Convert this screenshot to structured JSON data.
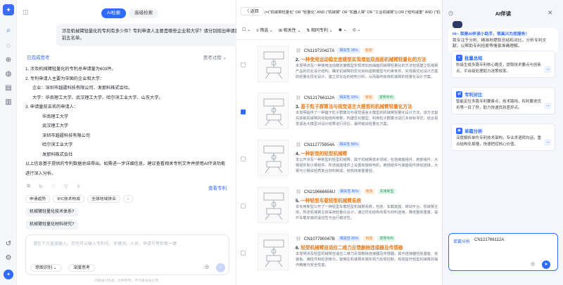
{
  "rail": {
    "logo": "✦",
    "icons": [
      "search-icon",
      "chat-icon",
      "globe-icon",
      "compass-icon",
      "document-icon",
      "book-icon",
      "history-icon",
      "settings-icon"
    ],
    "avatar": "✦"
  },
  "chat": {
    "tabs": [
      "AI检索",
      "高级检索"
    ],
    "user_question": "涉及机械臂轻量化的专利有多少件？专利申请人主要是哪些企业和大学？请分别按出申请量前五名单。",
    "thinking_label": "已完成思考",
    "thinking_toggle": "思考过程 ⌄",
    "answer_lines": [
      {
        "text": "1. 涉及机械臂轻量化的专利总申请量为603件。",
        "indent": 0
      },
      {
        "text": "2. 专利申请人主要为中国的企业和大学：",
        "indent": 0
      },
      {
        "text": "企业：深圳市越疆科技有限公司、发那科株式会社。",
        "indent": 1
      },
      {
        "text": "大学：华南理工大学、武汉理工大学、哈尔滨工业大学、山东大学。",
        "indent": 1
      },
      {
        "text": "3. 申请量前五名的申请人：",
        "indent": 0
      },
      {
        "text": "华南理工大学",
        "indent": 2
      },
      {
        "text": "武汉理工大学",
        "indent": 2
      },
      {
        "text": "深圳市越疆科技有限公司",
        "indent": 2
      },
      {
        "text": "哈尔滨工业大学",
        "indent": 2
      },
      {
        "text": "发那科株式会社",
        "indent": 2
      },
      {
        "text": "以上信息基于提供的专利数据总结得出。如需进一步详细信息，建议查看相关专利文件并使用AI伴读功能进行深入分析。",
        "indent": 0
      }
    ],
    "view_patents": "查看专利",
    "chips": [
      "申请趋势",
      "IPC技术构成",
      "全球地域排名"
    ],
    "chip_more": "›",
    "suggestions": [
      "机械臂轻量化技术体系?",
      "机械臂轻量化材料研究?"
    ],
    "input_placeholder": "请在下方直接输入，您也可以输入专利号、关键词、人名、申请号等检索一键",
    "mode_select": "意图识别 ⌄",
    "deep_think": "深度思考",
    "footer": "内容由AI生成，仅供参考，不代表本站立场"
  },
  "results": {
    "back": "〈 返回",
    "query": "(=(\"机械臂轻量化\" OR \"轻量化\" AND (\"机械臂\" OR \"机器人臂\" OR \"工业机械臂\")) OR (\"结构减重\" AND (\"机械臂\" OR",
    "filters": [
      "☐ ⌄",
      "≡ 筛选 ⌄",
      "⊞ 相关性 ⌄",
      "⇅ 相同专利 ⌄",
      "◉ ⌄",
      "◎ ⌄"
    ],
    "items": [
      {
        "no": "CN119720427A",
        "tags": [
          [
            "相关性 95%",
            "b"
          ],
          [
            "有效",
            "o"
          ]
        ],
        "title_pre": "2. ",
        "title_hl": "一种使用运动稳定度模型实现增加双曲面机械臂轻量化的方法",
        "abstract": "本发明涉及一种使用运动稳定度模型实现增加双曲面机械臂轻量化的方法包括建立机械臂产品的优化设计结构，确定机械臂的优化目标函数模型与约束条件，实现最优化设计方案的轻量化优化设计，建立优化后的结构分析，从而最终获得机械臂的轻量化设计方案。",
        "checked": false
      },
      {
        "no": "CN121766112A",
        "tags": [
          [
            "相关性 92%",
            "b"
          ],
          [
            "有效",
            "o"
          ],
          [
            "发明专利",
            "g"
          ]
        ],
        "title_pre": "3. ",
        "title_hl": "基于粒子群算法与视觉语言大模型的机械臂轻量化方法",
        "abstract": "本发明提供了一种基于粒子群算法与视觉语言大模型的机械臂轻量化设计方法，该方法首先获取机械臂的初始结构参数，构建优化模型，利用粒子群算法进行多目标寻优，结合视觉语言大模型对设计结果进行评估，最终输出轻量化方案。",
        "checked": true
      },
      {
        "no": "CN112775954A",
        "tags": [
          [
            "相关性 86%",
            "b"
          ]
        ],
        "title_pre": "4. ",
        "title_hl": "一种新型的轻型机械臂",
        "abstract": "本公开涉及一种新型的轻型机械臂，属于机械臂技术领域，包括底座组件、肩部组件、大臂组件和小臂组件，所述底座组件上设置有旋转电机，肩部组件与底座组件转动连接，大臂与小臂由轻质复合材料制成，结构简单重量轻。",
        "checked": false
      },
      {
        "no": "CN219666656U",
        "tags": [
          [
            "相关性 85%",
            "b"
          ],
          [
            "有效",
            "o"
          ],
          [
            "实用新型",
            "g"
          ]
        ],
        "title_pre": "5. ",
        "title_hl": "一种轻型车载轻型机械臂系统",
        "abstract": "本实用新型公开了一种轻型车载轻型机械臂系统，包括：车载底座、转动平台、机械臂主体，所述机械臂主体采用轻量化设计，通过优化结构布局与材料选用，降低整体重量，提升车载安装的适应性与运行稳定性。",
        "checked": false
      },
      {
        "no": "CN107790047B",
        "tags": [
          [
            "相关性 85%",
            "b"
          ],
          [
            "有效",
            "o"
          ],
          [
            "发明专利",
            "g"
          ]
        ],
        "title_pre": "6. ",
        "title_hl": "轻型机械臂自适应二维力反馈删除连接器及传感器",
        "abstract": "本发明涉及轻型机械臂自适应二维力反馈删除连接器及传感器，其中连接器包括基座、安装板、弹性件和检测单元，能够在机械臂末端实现力反馈控制，有效提升轻型机械臂的操作精度与安全性能。",
        "checked": false
      }
    ]
  },
  "ai": {
    "title": "AI伴读",
    "greeting_hi": "Hi~ 我是AI伴读小助手，很高兴为您服务！",
    "greeting_body": "我专注于分析、精准地提取总结和对比，分析专利文献，以帮助专利检索等情景准确理解。",
    "cards": [
      {
        "title": "批量总结",
        "desc": "秒级生成多篇专利核心概览，提取技术要点与创新点，平台级处理助力决策效率。"
      },
      {
        "title": "专利对比",
        "desc": "智能定位多篇专利要素点，技术路线，权利要求优劣等一目了然，助力快速找到差异点。"
      },
      {
        "title": "单篇分析",
        "desc": "深度解析单件专利技术架构，专业术语转白话，重点结构化易懂，快速把控核心价值。"
      }
    ],
    "input_label": "单篇分析",
    "input_value": "CN121766112A"
  }
}
